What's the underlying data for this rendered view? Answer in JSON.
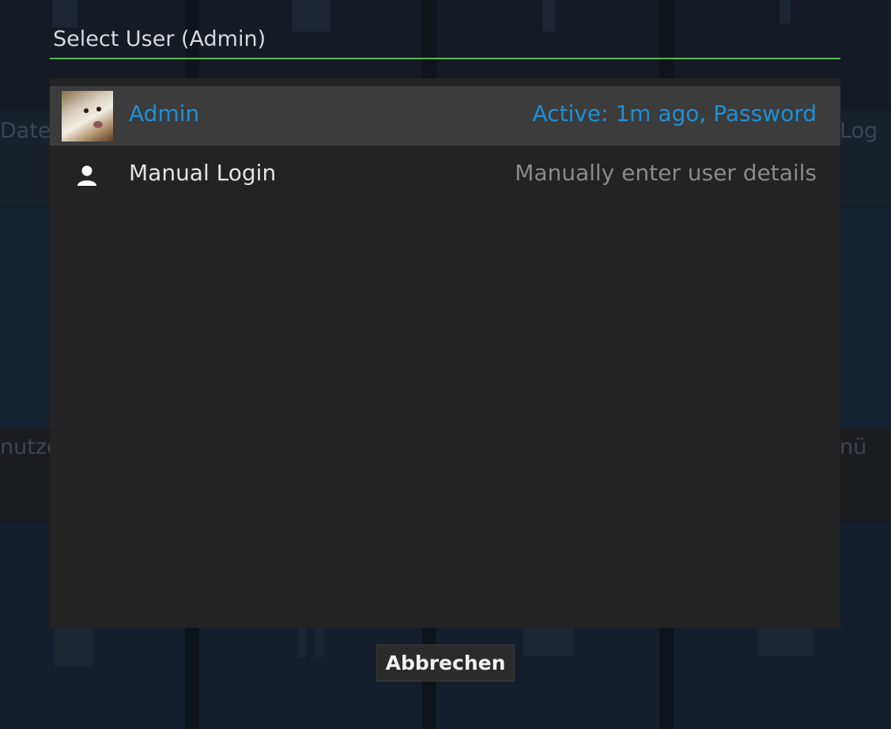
{
  "dialog": {
    "title": "Select User (Admin)",
    "accent_color": "#5cb85c",
    "selected_color": "#1e8fd6"
  },
  "users": [
    {
      "name": "Admin",
      "detail": "Active: 1m ago, Password",
      "icon": "dog-avatar-photo",
      "selected": true
    },
    {
      "name": "Manual Login",
      "detail": "Manually enter user details",
      "icon": "person-icon",
      "selected": false
    }
  ],
  "footer": {
    "cancel_label": "Abbrechen"
  },
  "background_labels": [
    "Date",
    "Log",
    "nutze",
    "nü"
  ]
}
